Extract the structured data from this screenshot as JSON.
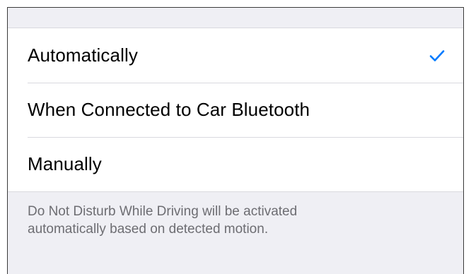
{
  "options": [
    {
      "label": "Automatically",
      "selected": true
    },
    {
      "label": "When Connected to Car Bluetooth",
      "selected": false
    },
    {
      "label": "Manually",
      "selected": false
    }
  ],
  "footer": {
    "line1": "Do Not Disturb While Driving will be activated",
    "line2": "automatically based on detected motion."
  },
  "colors": {
    "accent": "#007aff",
    "background": "#efeff4",
    "footer_text": "#6d6d72"
  },
  "icons": {
    "selected": "checkmark-icon"
  }
}
